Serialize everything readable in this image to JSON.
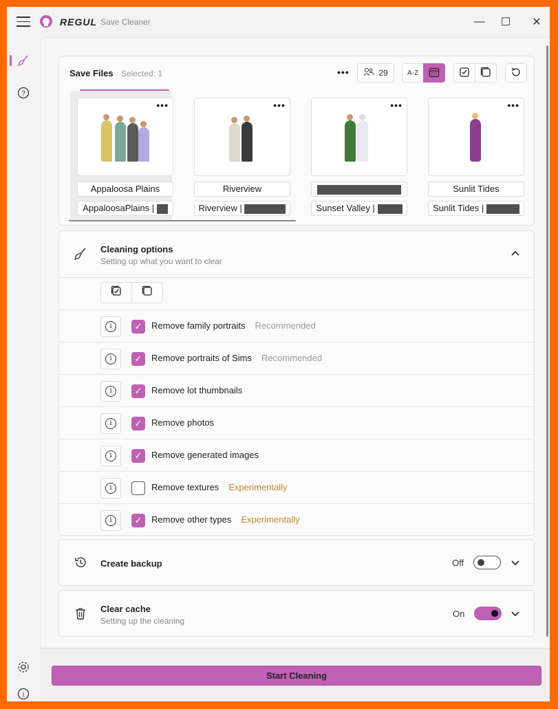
{
  "titlebar": {
    "brand": "REGUL",
    "app_title": "Save Cleaner",
    "minimize": "—",
    "maximize": "☐",
    "close": "✕"
  },
  "sidebar": {
    "items": [
      {
        "icon": "broom-icon",
        "active": true
      },
      {
        "icon": "help-icon",
        "active": false
      }
    ],
    "bottom_items": [
      {
        "icon": "gear-icon"
      },
      {
        "icon": "info-icon"
      }
    ]
  },
  "save_files": {
    "title": "Save Files",
    "selected_label": "Selected: 1",
    "more": "•••",
    "sims_count": "29",
    "sort_label": "A-Z",
    "items": [
      {
        "name": "Appaloosa Plains",
        "subtitle": "AppaloosaPlains |",
        "selected": true
      },
      {
        "name": "Riverview",
        "subtitle": "Riverview |",
        "selected": false
      },
      {
        "name": "",
        "subtitle": "Sunset Valley |",
        "selected": false
      },
      {
        "name": "Sunlit Tides",
        "subtitle": "Sunlit Tides |",
        "selected": false
      }
    ]
  },
  "cleaning_options": {
    "title": "Cleaning options",
    "subtitle": "Setting up what you want to clear",
    "options": [
      {
        "label": "Remove family portraits",
        "checked": true,
        "tag": "Recommended",
        "tag_type": "rec"
      },
      {
        "label": "Remove portraits of Sims",
        "checked": true,
        "tag": "Recommended",
        "tag_type": "rec"
      },
      {
        "label": "Remove lot thumbnails",
        "checked": true,
        "tag": "",
        "tag_type": ""
      },
      {
        "label": "Remove photos",
        "checked": true,
        "tag": "",
        "tag_type": ""
      },
      {
        "label": "Remove generated images",
        "checked": true,
        "tag": "",
        "tag_type": ""
      },
      {
        "label": "Remove textures",
        "checked": false,
        "tag": "Experimentally",
        "tag_type": "exp"
      },
      {
        "label": "Remove other types",
        "checked": true,
        "tag": "Experimentally",
        "tag_type": "exp"
      }
    ]
  },
  "backup": {
    "title": "Create backup",
    "state": "Off",
    "enabled": false
  },
  "cache": {
    "title": "Clear cache",
    "subtitle": "Setting up the cleaning",
    "state": "On",
    "enabled": true
  },
  "footer": {
    "start_label": "Start Cleaning"
  },
  "colors": {
    "accent": "#c060b4",
    "experimental": "#c08a2a",
    "frame": "#ff6a00"
  }
}
